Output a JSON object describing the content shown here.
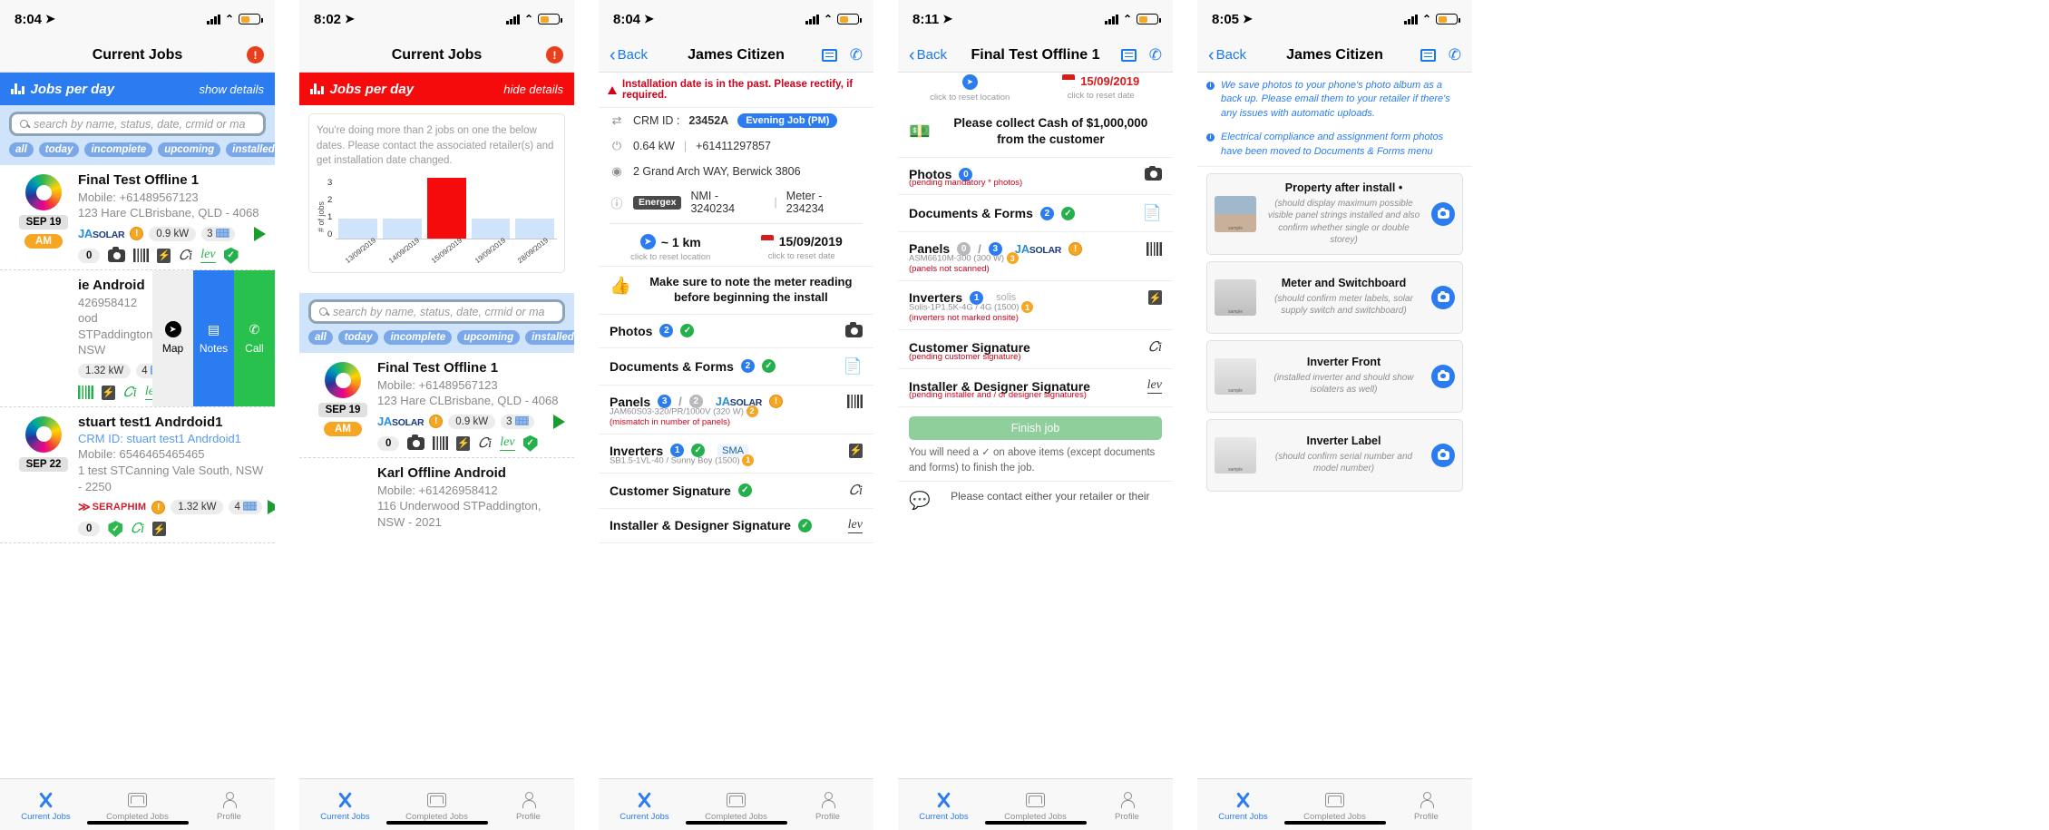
{
  "panels": [
    {
      "id": "current-jobs-list",
      "status": {
        "time": "8:04",
        "battery_color": "#f5a623"
      },
      "nav": {
        "title": "Current Jobs",
        "warning_icon": "warning-triangle-icon"
      },
      "banner": {
        "label": "Jobs per day",
        "action": "show details",
        "color": "#2b7cf0"
      },
      "search": {
        "placeholder": "search by name, status, date, crmid or ma"
      },
      "chips": [
        "all",
        "today",
        "incomplete",
        "upcoming",
        "installed"
      ],
      "cards": [
        {
          "name": "Final Test Offline 1",
          "mobile": "Mobile: +61489567123",
          "address": "123 Hare CLBrisbane, QLD - 4068",
          "date": "SEP 19",
          "ampm": "AM",
          "brand": "JA SOLAR",
          "kw": "0.9 kW",
          "panels": "3",
          "count": "0"
        },
        {
          "name": "ie Android",
          "mobile": "426958412",
          "address": "ood STPaddington, NSW",
          "kw": "1.32 kW",
          "panels": "4",
          "swipe": [
            "Map",
            "Notes",
            "Call"
          ]
        },
        {
          "name": "stuart test1 Andrdoid1",
          "crm": "CRM ID: stuart test1 Andrdoid1",
          "mobile": "Mobile: 6546465465465",
          "address": "1 test STCanning Vale South, NSW - 2250",
          "date": "SEP 22",
          "brand": "SERAPHIM",
          "kw": "1.32 kW",
          "panels": "4"
        }
      ],
      "tabs": [
        "Current Jobs",
        "Completed Jobs",
        "Profile"
      ]
    },
    {
      "id": "current-jobs-chart",
      "status": {
        "time": "8:02",
        "battery_color": "#f5a623"
      },
      "nav": {
        "title": "Current Jobs",
        "warning_icon": "warning-triangle-icon"
      },
      "banner": {
        "label": "Jobs per day",
        "action": "hide details",
        "color": "#f50b0b"
      },
      "chart_note": "You're doing more than 2 jobs on one the below dates. Please contact the associated retailer(s) and get installation date changed.",
      "search": {
        "placeholder": "search by name, status, date, crmid or ma"
      },
      "chips": [
        "all",
        "today",
        "incomplete",
        "upcoming",
        "installed"
      ],
      "cards": [
        {
          "name": "Final Test Offline 1",
          "mobile": "Mobile: +61489567123",
          "address": "123 Hare CLBrisbane, QLD - 4068",
          "date": "SEP 19",
          "ampm": "AM",
          "brand": "JA SOLAR",
          "kw": "0.9 kW",
          "panels": "3",
          "count": "0"
        },
        {
          "name": "Karl Offline Android",
          "mobile": "Mobile: +61426958412",
          "address": "116 Underwood STPaddington, NSW - 2021"
        }
      ],
      "tabs": [
        "Current Jobs",
        "Completed Jobs",
        "Profile"
      ]
    },
    {
      "id": "job-detail-james-citizen",
      "status": {
        "time": "8:04",
        "battery_color": "#f5a623"
      },
      "nav": {
        "back": "Back",
        "title": "James Citizen"
      },
      "alert": "Installation date is in the past. Please rectify, if required.",
      "details": [
        {
          "icon": "swap-icon",
          "label": "CRM ID :",
          "value": "23452A",
          "tag": "Evening Job (PM)"
        },
        {
          "icon": "power-icon",
          "label": "0.64 kW",
          "sep": "|",
          "value": "+61411297857"
        },
        {
          "icon": "location-icon",
          "label": "2 Grand Arch WAY, Berwick 3806"
        },
        {
          "icon": "info-icon",
          "tagdark": "Energex",
          "label": "NMI - 3240234",
          "sep": "|",
          "value": "Meter - 234234"
        }
      ],
      "location": {
        "value": "~ 1 km",
        "caption": "click to reset location"
      },
      "date": {
        "value": "15/09/2019",
        "caption": "click to reset date"
      },
      "notice": "Make sure to note the meter reading before beginning the install",
      "rows": [
        {
          "label": "Photos",
          "count": "2",
          "check": true,
          "icon": "camera-icon"
        },
        {
          "label": "Documents & Forms",
          "count": "2",
          "check": true,
          "icon": "document-icon"
        },
        {
          "label": "Panels",
          "count": "3",
          "count2": "2",
          "brand": "JA SOLAR",
          "warn": true,
          "detail": "JAM60S03-320/PR/1000V (320 W)",
          "detail_badge": "2",
          "note": "(mismatch in number of panels)",
          "icon": "barcode-icon"
        },
        {
          "label": "Inverters",
          "count": "1",
          "check": true,
          "brand": "SMA",
          "detail": "SB1.5-1VL-40 / Sunny Boy (1500)",
          "detail_badge": "1",
          "icon": "inverter-icon"
        },
        {
          "label": "Customer Signature",
          "check": true,
          "icon": "signature-icon"
        },
        {
          "label": "Installer & Designer Signature",
          "check": true,
          "icon": "signature2-icon"
        }
      ],
      "tabs": [
        "Current Jobs",
        "Completed Jobs",
        "Profile"
      ]
    },
    {
      "id": "job-detail-final-test-offline",
      "status": {
        "time": "8:11",
        "battery_color": "#f5a623"
      },
      "nav": {
        "back": "Back",
        "title": "Final Test Offline 1"
      },
      "top_partial": {
        "left_caption": "click to reset location",
        "right_value": "15/09/2019",
        "right_caption": "click to reset date"
      },
      "cash_notice": "Please collect Cash of $1,000,000 from the customer",
      "rows": [
        {
          "label": "Photos",
          "count": "0",
          "note": "(pending mandatory * photos)",
          "icon": "camera-icon"
        },
        {
          "label": "Documents & Forms",
          "count": "2",
          "check": true,
          "icon": "document-icon"
        },
        {
          "label": "Panels",
          "count": "0",
          "count2": "3",
          "brand": "JA SOLAR",
          "warn": true,
          "detail": "ASM6610M-300  (300 W)",
          "detail_badge": "3",
          "note": "(panels not scanned)",
          "icon": "barcode-icon"
        },
        {
          "label": "Inverters",
          "count": "1",
          "brand": "solis",
          "detail": "Solis-1P1.5K-4G / 4G (1500)",
          "detail_badge": "1",
          "note": "(inverters not marked onsite)",
          "icon": "inverter-icon"
        },
        {
          "label": "Customer Signature",
          "note": "(pending customer signature)",
          "icon": "signature-icon"
        },
        {
          "label": "Installer & Designer Signature",
          "note": "(pending installer and / or designer signatures)",
          "icon": "signature2-icon"
        }
      ],
      "finish_button": "Finish job",
      "finish_note": "You will need a ✓ on above items (except documents and forms) to finish the job.",
      "footer_partial": "Please contact either your retailer or their",
      "tabs": [
        "Current Jobs",
        "Completed Jobs",
        "Profile"
      ]
    },
    {
      "id": "photos-james-citizen",
      "status": {
        "time": "8:05",
        "battery_color": "#f5a623"
      },
      "nav": {
        "back": "Back",
        "title": "James Citizen"
      },
      "notes": [
        "We save photos to your phone's photo album as a back up. Please email them to your retailer if there's any issues with automatic uploads.",
        "Electrical compliance and assignment form photos have been moved to Documents & Forms menu"
      ],
      "photos": [
        {
          "title": "Property after install",
          "required": true,
          "desc": "(should display maximum possible visible panel strings installed and also confirm whether single or double storey)",
          "thumb": "roof-photo-thumb",
          "sample": "sample"
        },
        {
          "title": "Meter and Switchboard",
          "desc": "(should confirm meter labels, solar supply switch and switchboard)",
          "thumb": "meter-photo-thumb",
          "sample": "sample"
        },
        {
          "title": "Inverter Front",
          "desc": "(installed inverter and should show isolaters as well)",
          "thumb": "inverter-photo-thumb",
          "sample": "sample"
        },
        {
          "title": "Inverter Label",
          "desc": "(should confirm serial number and model number)",
          "thumb": "inverter-label-thumb",
          "sample": "sample"
        }
      ],
      "tabs": [
        "Current Jobs",
        "Completed Jobs",
        "Profile"
      ]
    }
  ],
  "chart_data": {
    "type": "bar",
    "title": "Jobs per day",
    "xlabel": "",
    "ylabel": "# of jobs",
    "categories": [
      "13/09/2019",
      "14/09/2019",
      "15/09/2019",
      "19/09/2019",
      "28/09/2019"
    ],
    "values": [
      1,
      1,
      3,
      1,
      1
    ],
    "ylim": [
      0,
      3
    ],
    "yticks": [
      3,
      2,
      1,
      0
    ],
    "highlight_index": 2,
    "colors": {
      "bar": "#cfe4fa",
      "highlight": "#f50b0b"
    },
    "grid": false,
    "legend": "none"
  }
}
